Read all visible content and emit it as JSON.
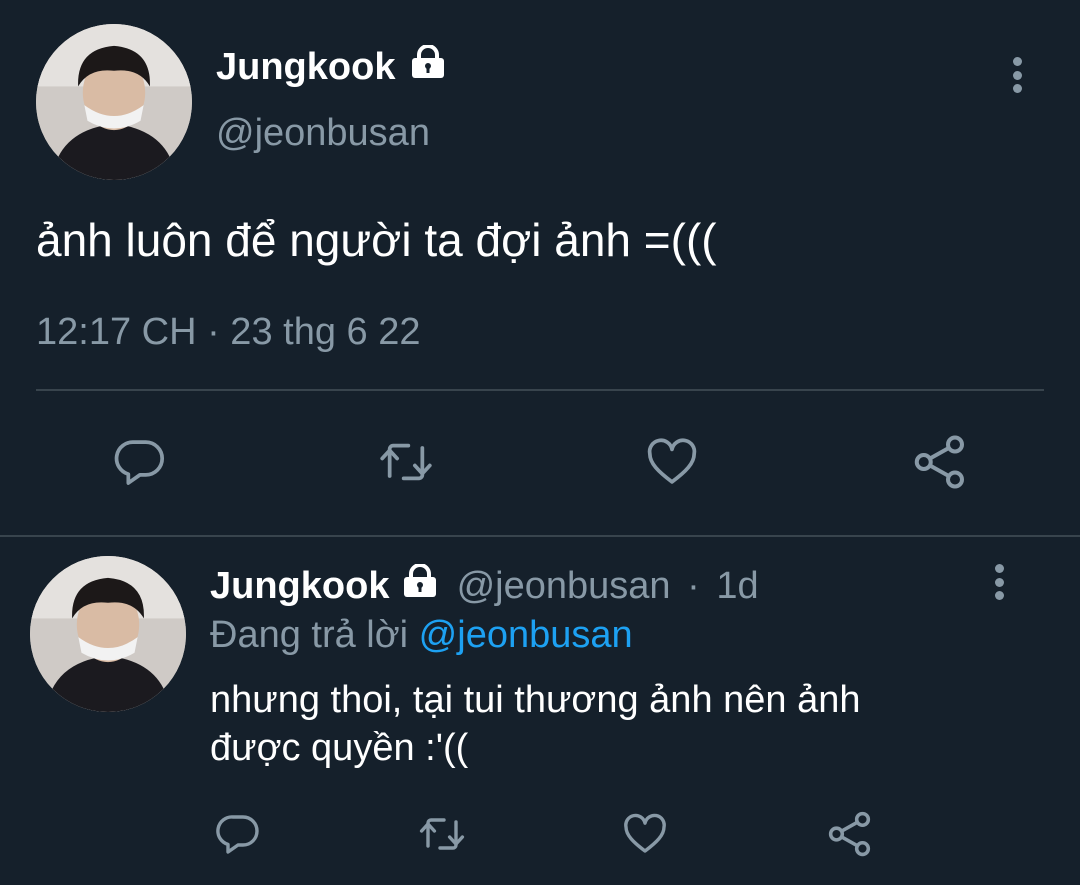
{
  "main_tweet": {
    "author_name": "Jungkook",
    "lock_icon": "lock-icon",
    "handle": "@jeonbusan",
    "text": "ảnh luôn để người ta đợi ảnh =(((",
    "timestamp": "12:17 CH · 23 thg 6 22",
    "actions": [
      "reply-icon",
      "retweet-icon",
      "like-icon",
      "share-icon"
    ]
  },
  "reply_tweet": {
    "author_name": "Jungkook",
    "handle": "@jeonbusan",
    "separator": "·",
    "time_ago": "1d",
    "replying_prefix": "Đang trả lời",
    "replying_to": "@jeonbusan",
    "text_line1": "nhưng thoi, tại tui thương ảnh nên ảnh",
    "text_line2": "được quyền :'((",
    "actions": [
      "reply-icon",
      "retweet-icon",
      "like-icon",
      "share-icon"
    ]
  },
  "colors": {
    "background": "#15202b",
    "text": "#ffffff",
    "muted": "#8899a6",
    "link": "#1da1f2",
    "divider": "#38444d"
  }
}
